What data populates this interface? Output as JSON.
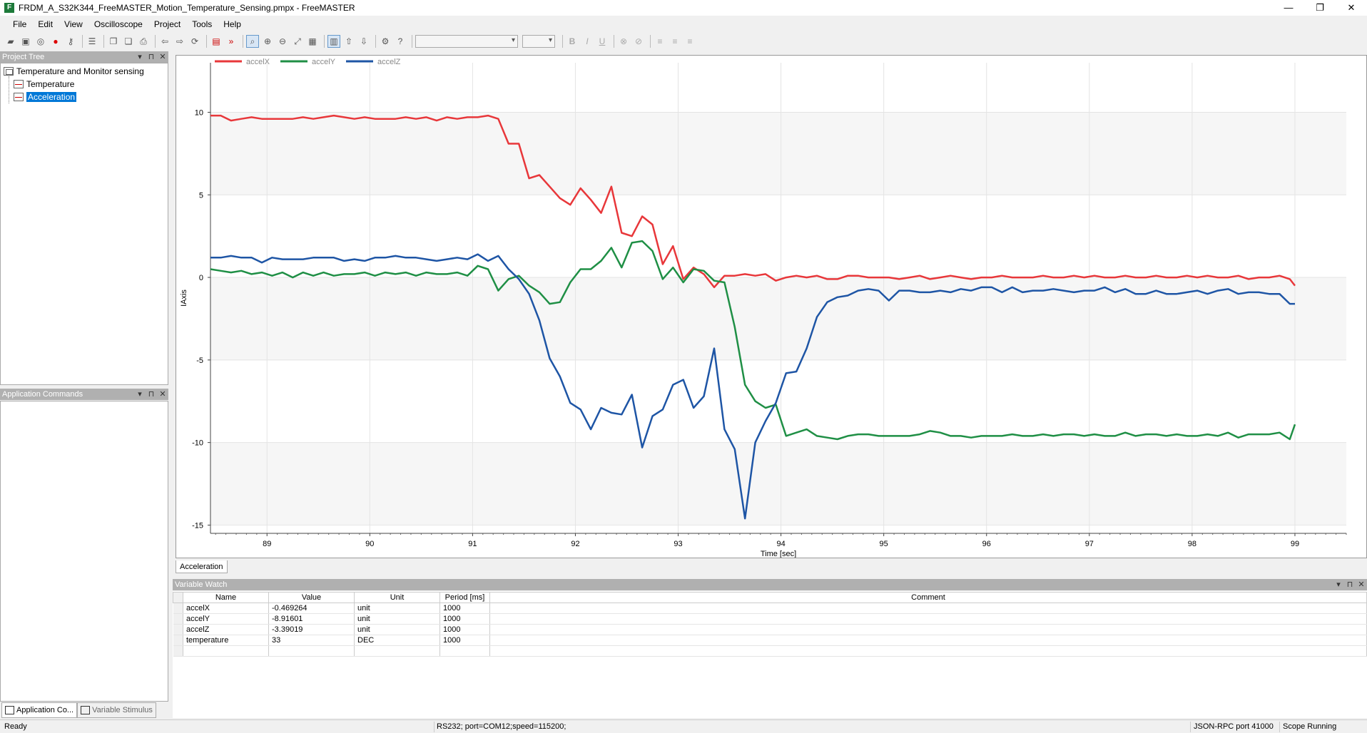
{
  "window": {
    "title": "FRDM_A_S32K344_FreeMASTER_Motion_Temperature_Sensing.pmpx - FreeMASTER",
    "minimize": "—",
    "maximize": "❐",
    "close": "✕"
  },
  "menu": [
    "File",
    "Edit",
    "View",
    "Oscilloscope",
    "Project",
    "Tools",
    "Help"
  ],
  "toolbar_icons": [
    "open-folder-icon",
    "save-icon",
    "disk-icon",
    "stop-icon",
    "key-icon",
    "list-icon",
    "copy-icon",
    "paste-icon",
    "print-icon",
    "back-icon",
    "forward-icon",
    "refresh-icon",
    "record-icon",
    "double-arrow-icon",
    "zoom-icon",
    "zoom-in-icon",
    "zoom-out-icon",
    "zoom-fit-icon",
    "camera-icon",
    "grid-icon",
    "up-icon",
    "down-icon",
    "options-icon",
    "help-icon",
    "bold-icon",
    "italic-icon",
    "underline-icon",
    "link-icon",
    "unlink-icon",
    "align-left-icon",
    "align-center-icon",
    "align-right-icon"
  ],
  "format": {
    "bold": "B",
    "italic": "I",
    "underline": "U"
  },
  "project_tree": {
    "title": "Project Tree",
    "root": "Temperature and Monitor sensing",
    "items": [
      "Temperature",
      "Acceleration"
    ],
    "selected": "Acceleration"
  },
  "app_commands": {
    "title": "Application Commands"
  },
  "left_tabs": [
    "Application Co...",
    "Variable Stimulus"
  ],
  "chart_tab": "Acceleration",
  "chart_data": {
    "type": "line",
    "xlabel": "Time [sec]",
    "ylabel": "IAxis",
    "xlim": [
      88.45,
      99.5
    ],
    "ylim": [
      -15.5,
      13
    ],
    "xticks": [
      89,
      90,
      91,
      92,
      93,
      94,
      95,
      96,
      97,
      98,
      99
    ],
    "yticks": [
      10,
      5,
      0,
      -5,
      -10,
      -15
    ],
    "grid": true,
    "legend": "top-left",
    "x": [
      88.45,
      88.55,
      88.65,
      88.75,
      88.85,
      88.95,
      89.05,
      89.15,
      89.25,
      89.35,
      89.45,
      89.55,
      89.65,
      89.75,
      89.85,
      89.95,
      90.05,
      90.15,
      90.25,
      90.35,
      90.45,
      90.55,
      90.65,
      90.75,
      90.85,
      90.95,
      91.05,
      91.15,
      91.25,
      91.35,
      91.45,
      91.55,
      91.65,
      91.75,
      91.85,
      91.95,
      92.05,
      92.15,
      92.25,
      92.35,
      92.45,
      92.55,
      92.65,
      92.75,
      92.85,
      92.95,
      93.05,
      93.15,
      93.25,
      93.35,
      93.45,
      93.55,
      93.65,
      93.75,
      93.85,
      93.95,
      94.05,
      94.15,
      94.25,
      94.35,
      94.45,
      94.55,
      94.65,
      94.75,
      94.85,
      94.95,
      95.05,
      95.15,
      95.25,
      95.35,
      95.45,
      95.55,
      95.65,
      95.75,
      95.85,
      95.95,
      96.05,
      96.15,
      96.25,
      96.35,
      96.45,
      96.55,
      96.65,
      96.75,
      96.85,
      96.95,
      97.05,
      97.15,
      97.25,
      97.35,
      97.45,
      97.55,
      97.65,
      97.75,
      97.85,
      97.95,
      98.05,
      98.15,
      98.25,
      98.35,
      98.45,
      98.55,
      98.65,
      98.75,
      98.85,
      98.95,
      99.0
    ],
    "series": [
      {
        "name": "accelX",
        "color": "#e8373a",
        "values": [
          9.8,
          9.8,
          9.5,
          9.6,
          9.7,
          9.6,
          9.6,
          9.6,
          9.6,
          9.7,
          9.6,
          9.7,
          9.8,
          9.7,
          9.6,
          9.7,
          9.6,
          9.6,
          9.6,
          9.7,
          9.6,
          9.7,
          9.5,
          9.7,
          9.6,
          9.7,
          9.7,
          9.8,
          9.6,
          8.1,
          8.1,
          6.0,
          6.2,
          5.5,
          4.8,
          4.4,
          5.4,
          4.7,
          3.9,
          5.5,
          2.7,
          2.5,
          3.7,
          3.2,
          0.8,
          1.9,
          -0.1,
          0.6,
          0.2,
          -0.6,
          0.1,
          0.1,
          0.2,
          0.1,
          0.2,
          -0.2,
          0.0,
          0.1,
          0.0,
          0.1,
          -0.1,
          -0.1,
          0.1,
          0.1,
          0.0,
          0.0,
          0.0,
          -0.1,
          0.0,
          0.1,
          -0.1,
          0.0,
          0.1,
          0.0,
          -0.1,
          0.0,
          0.0,
          0.1,
          0.0,
          0.0,
          0.0,
          0.1,
          0.0,
          0.0,
          0.1,
          0.0,
          0.1,
          0.0,
          0.0,
          0.1,
          0.0,
          0.0,
          0.1,
          0.0,
          0.0,
          0.1,
          0.0,
          0.1,
          0.0,
          0.0,
          0.1,
          -0.1,
          0.0,
          0.0,
          0.1,
          -0.1,
          -0.5
        ]
      },
      {
        "name": "accelY",
        "color": "#1f8f45",
        "values": [
          0.5,
          0.4,
          0.3,
          0.4,
          0.2,
          0.3,
          0.1,
          0.3,
          0.0,
          0.3,
          0.1,
          0.3,
          0.1,
          0.2,
          0.2,
          0.3,
          0.1,
          0.3,
          0.2,
          0.3,
          0.1,
          0.3,
          0.2,
          0.2,
          0.3,
          0.1,
          0.7,
          0.5,
          -0.8,
          -0.1,
          0.1,
          -0.5,
          -0.9,
          -1.6,
          -1.5,
          -0.3,
          0.5,
          0.5,
          1.0,
          1.8,
          0.6,
          2.1,
          2.2,
          1.6,
          -0.1,
          0.6,
          -0.3,
          0.5,
          0.4,
          -0.2,
          -0.3,
          -3.0,
          -6.5,
          -7.5,
          -7.9,
          -7.7,
          -9.6,
          -9.4,
          -9.2,
          -9.6,
          -9.7,
          -9.8,
          -9.6,
          -9.5,
          -9.5,
          -9.6,
          -9.6,
          -9.6,
          -9.6,
          -9.5,
          -9.3,
          -9.4,
          -9.6,
          -9.6,
          -9.7,
          -9.6,
          -9.6,
          -9.6,
          -9.5,
          -9.6,
          -9.6,
          -9.5,
          -9.6,
          -9.5,
          -9.5,
          -9.6,
          -9.5,
          -9.6,
          -9.6,
          -9.4,
          -9.6,
          -9.5,
          -9.5,
          -9.6,
          -9.5,
          -9.6,
          -9.6,
          -9.5,
          -9.6,
          -9.4,
          -9.7,
          -9.5,
          -9.5,
          -9.5,
          -9.4,
          -9.8,
          -8.9
        ]
      },
      {
        "name": "accelZ",
        "color": "#1e55a5",
        "values": [
          1.2,
          1.2,
          1.3,
          1.2,
          1.2,
          0.9,
          1.2,
          1.1,
          1.1,
          1.1,
          1.2,
          1.2,
          1.2,
          1.0,
          1.1,
          1.0,
          1.2,
          1.2,
          1.3,
          1.2,
          1.2,
          1.1,
          1.0,
          1.1,
          1.2,
          1.1,
          1.4,
          1.0,
          1.3,
          0.5,
          -0.1,
          -1.0,
          -2.6,
          -4.9,
          -6.0,
          -7.6,
          -8.0,
          -9.2,
          -7.9,
          -8.2,
          -8.3,
          -7.1,
          -10.3,
          -8.4,
          -8.0,
          -6.5,
          -6.2,
          -7.9,
          -7.2,
          -4.3,
          -9.2,
          -10.4,
          -14.6,
          -10.0,
          -8.7,
          -7.6,
          -5.8,
          -5.7,
          -4.3,
          -2.4,
          -1.5,
          -1.2,
          -1.1,
          -0.8,
          -0.7,
          -0.8,
          -1.4,
          -0.8,
          -0.8,
          -0.9,
          -0.9,
          -0.8,
          -0.9,
          -0.7,
          -0.8,
          -0.6,
          -0.6,
          -0.9,
          -0.6,
          -0.9,
          -0.8,
          -0.8,
          -0.7,
          -0.8,
          -0.9,
          -0.8,
          -0.8,
          -0.6,
          -0.9,
          -0.7,
          -1.0,
          -1.0,
          -0.8,
          -1.0,
          -1.0,
          -0.9,
          -0.8,
          -1.0,
          -0.8,
          -0.7,
          -1.0,
          -0.9,
          -0.9,
          -1.0,
          -1.0,
          -1.6,
          -1.6
        ]
      }
    ]
  },
  "variable_watch": {
    "title": "Variable Watch",
    "columns": [
      "Name",
      "Value",
      "Unit",
      "Period [ms]",
      "Comment"
    ],
    "rows": [
      [
        "accelX",
        "-0.469264",
        "unit",
        "1000",
        ""
      ],
      [
        "accelY",
        "-8.91601",
        "unit",
        "1000",
        ""
      ],
      [
        "accelZ",
        "-3.39019",
        "unit",
        "1000",
        ""
      ],
      [
        "temperature",
        "33",
        "DEC",
        "1000",
        ""
      ]
    ]
  },
  "status": {
    "left": "Ready",
    "connection": "RS232; port=COM12;speed=115200;",
    "rpc": "JSON-RPC port 41000",
    "scope": "Scope Running"
  }
}
